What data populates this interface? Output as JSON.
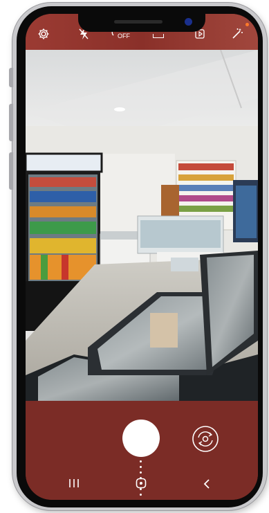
{
  "top_bar": {
    "settings_icon": "gear-icon",
    "flash_icon": "flash-off-icon",
    "timer_label": "OFF",
    "ratio_label": "Full",
    "motion_icon": "motion-photo-icon",
    "effects_icon": "magic-wand-icon",
    "notification_color": "#ff7a2a"
  },
  "controls": {
    "shutter_icon": "shutter-button",
    "switch_camera_icon": "switch-camera-icon"
  },
  "navigation": {
    "recents_icon": "recents-icon",
    "home_icon": "home-icon",
    "back_icon": "back-icon"
  },
  "colors": {
    "bar": "#8a3029",
    "accent": "#ffffff"
  }
}
